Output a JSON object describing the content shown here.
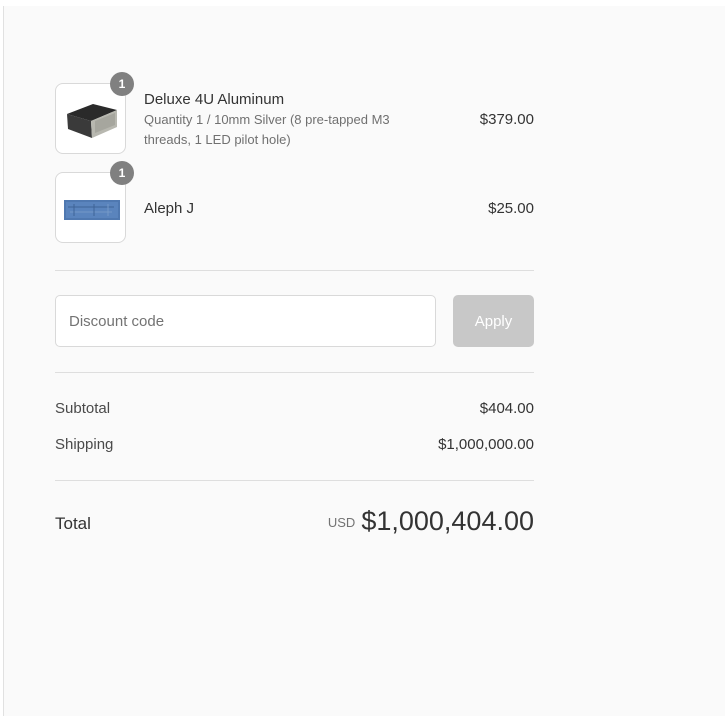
{
  "line_items": [
    {
      "quantity": "1",
      "name": "Deluxe 4U Aluminum",
      "variant": "Quantity 1 / 10mm Silver (8 pre-tapped M3 threads, 1 LED pilot hole)",
      "price": "$379.00",
      "image": "aluminum-enclosure-image"
    },
    {
      "quantity": "1",
      "name": "Aleph J",
      "variant": "",
      "price": "$25.00",
      "image": "blue-pcb-image"
    }
  ],
  "discount": {
    "placeholder": "Discount code",
    "value": "",
    "apply_label": "Apply"
  },
  "summary": {
    "subtotal_label": "Subtotal",
    "subtotal_value": "$404.00",
    "shipping_label": "Shipping",
    "shipping_value": "$1,000,000.00"
  },
  "total": {
    "label": "Total",
    "currency": "USD",
    "amount": "$1,000,404.00"
  },
  "colors": {
    "panel_background": "#fafafa",
    "badge": "#808080",
    "apply_disabled": "#c8c8c8",
    "divider": "#dedede"
  }
}
